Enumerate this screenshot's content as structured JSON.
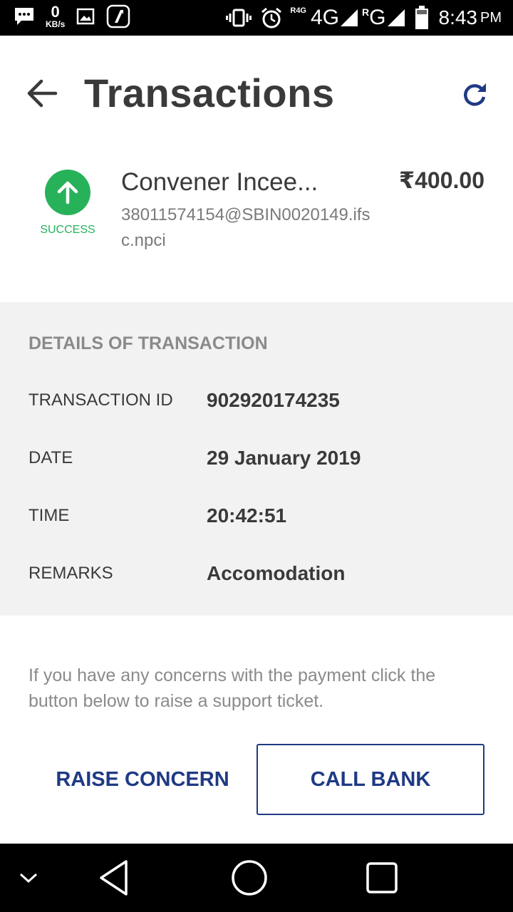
{
  "status_bar": {
    "data_speed": "0",
    "data_unit": "KB/s",
    "roaming_label": "R4G",
    "network_4g": "4G",
    "network_g": "G",
    "roaming_r": "R",
    "time": "8:43",
    "ampm": "PM"
  },
  "header": {
    "title": "Transactions"
  },
  "transaction": {
    "status": "SUCCESS",
    "payee": "Convener Incee...",
    "vpa": "38011574154@SBIN0020149.ifsc.npci",
    "amount": "₹400.00"
  },
  "details": {
    "title": "DETAILS OF TRANSACTION",
    "rows": [
      {
        "label": "TRANSACTION ID",
        "value": "902920174235"
      },
      {
        "label": "DATE",
        "value": "29 January 2019"
      },
      {
        "label": "TIME",
        "value": "20:42:51"
      },
      {
        "label": "REMARKS",
        "value": "Accomodation"
      }
    ]
  },
  "help_text": "If you have any concerns with the payment click the button below to raise a support ticket.",
  "buttons": {
    "raise_concern": "RAISE CONCERN",
    "call_bank": "CALL BANK"
  },
  "icons": {
    "back": "arrow-back-icon",
    "refresh": "refresh-icon",
    "status": "arrow-up-icon"
  },
  "colors": {
    "success": "#27b25a",
    "accent": "#1f3a84"
  }
}
